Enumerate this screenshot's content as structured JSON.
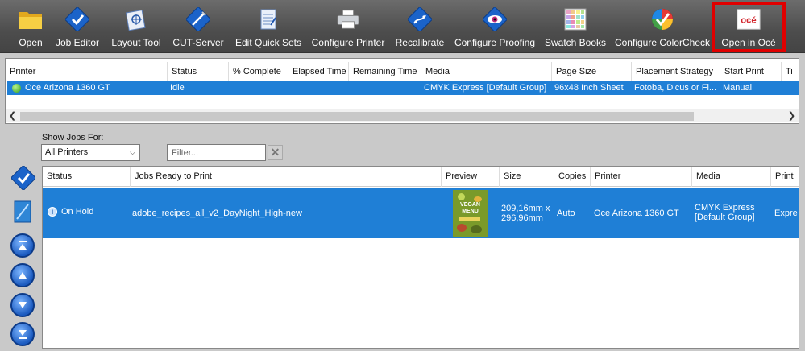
{
  "toolbar": {
    "buttons": [
      {
        "label": "Open",
        "icon": "folder-icon"
      },
      {
        "label": "Job Editor",
        "icon": "job-editor-icon"
      },
      {
        "label": "Layout Tool",
        "icon": "layout-tool-icon"
      },
      {
        "label": "CUT-Server",
        "icon": "cut-server-icon"
      },
      {
        "label": "Edit Quick Sets",
        "icon": "quick-sets-icon"
      },
      {
        "label": "Configure Printer",
        "icon": "printer-icon"
      },
      {
        "label": "Recalibrate",
        "icon": "recalibrate-icon"
      },
      {
        "label": "Configure Proofing",
        "icon": "proofing-eye-icon"
      },
      {
        "label": "Swatch Books",
        "icon": "swatch-grid-icon"
      },
      {
        "label": "Configure ColorCheck",
        "icon": "colorcheck-wheel-icon"
      },
      {
        "label": "Open in Océ",
        "icon": "oce-logo-icon",
        "logo_text": "océ"
      }
    ],
    "highlight_color": "#e00000"
  },
  "printers": {
    "columns": [
      "Printer",
      "Status",
      "% Complete",
      "Elapsed Time",
      "Remaining Time",
      "Media",
      "Page Size",
      "Placement Strategy",
      "Start Print",
      "Ti"
    ],
    "rows": [
      {
        "printer": "Oce Arizona 1360 GT",
        "status": "Idle",
        "percent_complete": "",
        "elapsed": "",
        "remaining": "",
        "media": "CMYK Express [Default Group]",
        "page_size": "96x48 Inch Sheet",
        "placement": "Fotoba, Dicus or Fl...",
        "start_print": "Manual"
      }
    ]
  },
  "filters": {
    "show_jobs_label": "Show Jobs For:",
    "printer_select_value": "All Printers",
    "filter_placeholder": "Filter..."
  },
  "jobs": {
    "columns": [
      "Status",
      "Jobs Ready to Print",
      "Preview",
      "Size",
      "Copies",
      "Printer",
      "Media",
      "Print"
    ],
    "rows": [
      {
        "status": "On Hold",
        "name": "adobe_recipes_all_v2_DayNight_High-new",
        "preview_text": [
          "VEGAN",
          "MENU"
        ],
        "size_line1": "209,16mm x",
        "size_line2": "296,96mm",
        "copies": "Auto",
        "printer": "Oce Arizona 1360 GT",
        "media_line1": "CMYK Express",
        "media_line2": "[Default Group]",
        "print": "Expre"
      }
    ]
  },
  "colors": {
    "selection": "#1f7fd6",
    "toolbar_bg": "#4d4d4d"
  }
}
